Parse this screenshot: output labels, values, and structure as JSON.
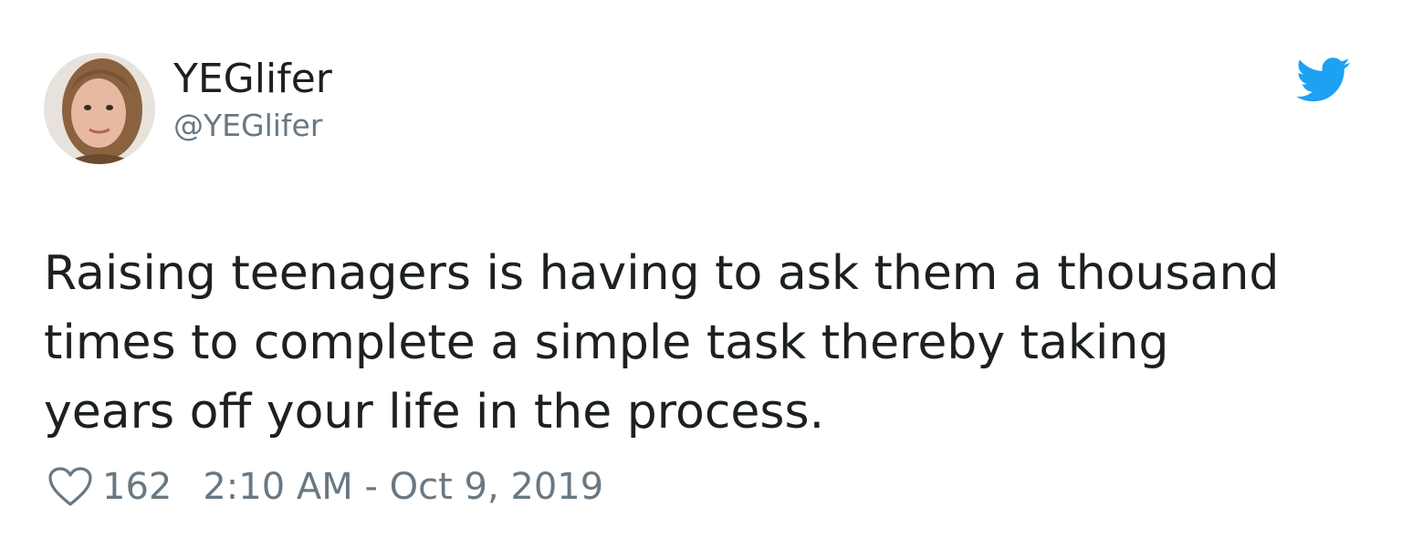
{
  "author": {
    "display_name": "YEGlifer",
    "handle": "@YEGlifer",
    "avatar_icon": "user-photo-avatar",
    "platform_icon": "twitter-bird-icon"
  },
  "tweet": {
    "text_lines": [
      "Raising teenagers is having to ask them a thousand",
      "times to complete a simple task thereby taking",
      "years off your life in the process."
    ]
  },
  "footer": {
    "like_icon": "heart-icon",
    "like_count": "162",
    "timestamp": "2:10 AM - Oct 9, 2019"
  },
  "colors": {
    "text_primary": "#1c2022",
    "text_secondary": "#697882",
    "twitter_blue": "#1da1f2",
    "background": "#ffffff"
  }
}
